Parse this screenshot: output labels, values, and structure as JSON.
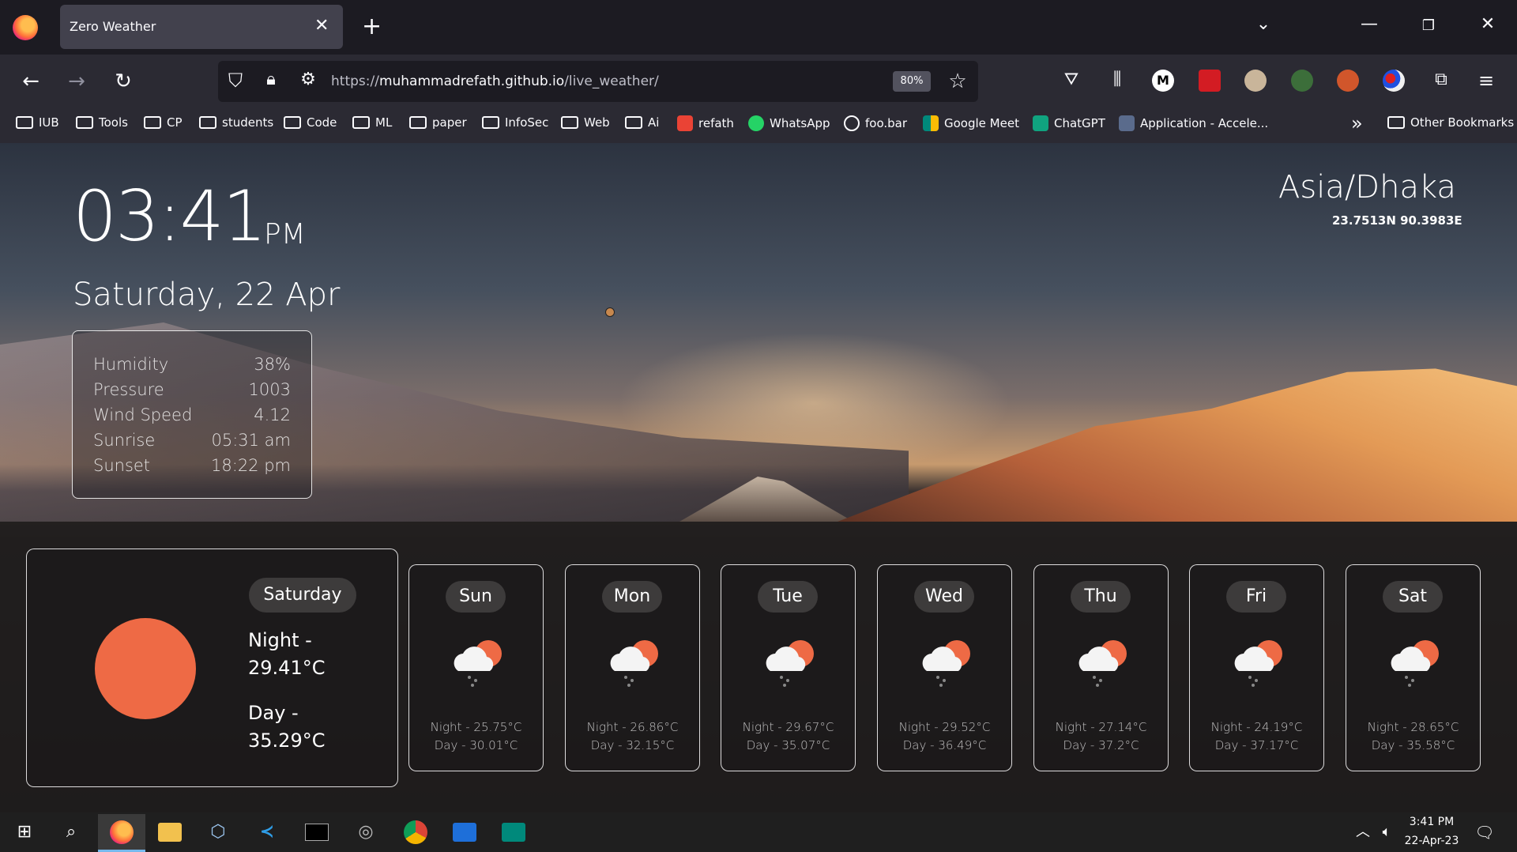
{
  "browser": {
    "tab_title": "Zero Weather",
    "url_prefix": "https://",
    "url_host": "muhammadrefath.github.io",
    "url_path": "/live_weather/",
    "zoom": "80%",
    "bookmarks": [
      {
        "label": "IUB",
        "type": "folder"
      },
      {
        "label": "Tools",
        "type": "folder"
      },
      {
        "label": "CP",
        "type": "folder"
      },
      {
        "label": "students",
        "type": "folder"
      },
      {
        "label": "Code",
        "type": "folder"
      },
      {
        "label": "ML",
        "type": "folder"
      },
      {
        "label": "paper",
        "type": "folder"
      },
      {
        "label": "InfoSec",
        "type": "folder"
      },
      {
        "label": "Web",
        "type": "folder"
      },
      {
        "label": "Ai",
        "type": "folder"
      },
      {
        "label": "refath",
        "type": "link",
        "icon": "gmail-icon",
        "color": "#ea4335"
      },
      {
        "label": "WhatsApp",
        "type": "link",
        "icon": "whatsapp-icon",
        "color": "#25d366"
      },
      {
        "label": "foo.bar",
        "type": "link",
        "icon": "globe-icon",
        "color": "#fbfbfe"
      },
      {
        "label": "Google Meet",
        "type": "link",
        "icon": "google-meet-icon",
        "color": "#00897b"
      },
      {
        "label": "ChatGPT",
        "type": "link",
        "icon": "chatgpt-icon",
        "color": "#10a37f"
      },
      {
        "label": "Application - Accele...",
        "type": "link",
        "icon": "rocket-icon",
        "color": "#8ab4f8"
      }
    ],
    "other_bookmarks": "Other Bookmarks"
  },
  "weather": {
    "time": "03:41",
    "ampm": "PM",
    "date": "Saturday, 22 Apr",
    "timezone": "Asia/Dhaka",
    "coords": "23.7513N 90.3983E",
    "stats": [
      {
        "label": "Humidity",
        "value": "38%"
      },
      {
        "label": "Pressure",
        "value": "1003"
      },
      {
        "label": "Wind Speed",
        "value": "4.12"
      },
      {
        "label": "Sunrise",
        "value": "05:31 am"
      },
      {
        "label": "Sunset",
        "value": "18:22 pm"
      }
    ],
    "today": {
      "day": "Saturday",
      "night_label": "Night -",
      "night_temp": "29.41°C",
      "day_label": "Day -",
      "day_temp": "35.29°C",
      "sun_color": "#ee6a45"
    },
    "forecast": [
      {
        "day": "Sun",
        "night": "Night - 25.75°C",
        "dayt": "Day - 30.01°C"
      },
      {
        "day": "Mon",
        "night": "Night - 26.86°C",
        "dayt": "Day - 32.15°C"
      },
      {
        "day": "Tue",
        "night": "Night - 29.67°C",
        "dayt": "Day - 35.07°C"
      },
      {
        "day": "Wed",
        "night": "Night - 29.52°C",
        "dayt": "Day - 36.49°C"
      },
      {
        "day": "Thu",
        "night": "Night - 27.14°C",
        "dayt": "Day - 37.2°C"
      },
      {
        "day": "Fri",
        "night": "Night - 24.19°C",
        "dayt": "Day - 37.17°C"
      },
      {
        "day": "Sat",
        "night": "Night - 28.65°C",
        "dayt": "Day - 35.58°C"
      }
    ]
  },
  "taskbar": {
    "time": "3:41 PM",
    "date": "22-Apr-23"
  }
}
